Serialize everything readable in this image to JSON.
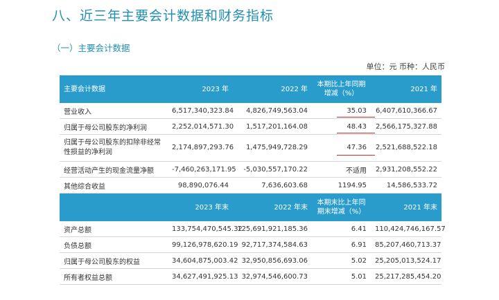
{
  "heading": "八、近三年主要会计数据和财务指标",
  "subheading": "（一）主要会计数据",
  "unit_line": "单位：元  币种：人民币",
  "table1": {
    "headers": [
      "主要会计数据",
      "2023 年",
      "2022 年",
      "本期比上年同期增减（%）",
      "2021 年"
    ],
    "rows": [
      {
        "name": "营业收入",
        "y2023": "6,517,340,323.84",
        "y2022": "4,826,749,563.04",
        "change": "35.03",
        "y2021": "6,407,610,366.67"
      },
      {
        "name": "归属于母公司股东的净利润",
        "y2023": "2,252,014,571.30",
        "y2022": "1,517,201,164.08",
        "change": "48.43",
        "y2021": "2,566,175,327.88"
      },
      {
        "name": "归属于母公司股东的扣除非经常性损益的净利润",
        "y2023": "2,174,897,293.76",
        "y2022": "1,475,949,728.29",
        "change": "47.36",
        "y2021": "2,521,688,522.18"
      },
      {
        "name": "经营活动产生的现金流量净额",
        "y2023": "-7,460,263,171.95",
        "y2022": "-5,030,557,170.22",
        "change": "不适用",
        "y2021": "2,931,208,552.22"
      },
      {
        "name": "其他综合收益",
        "y2023": "98,890,076.44",
        "y2022": "7,636,603.68",
        "change": "1194.95",
        "y2021": "14,586,533.72"
      }
    ]
  },
  "table2": {
    "headers": [
      "",
      "2023 年末",
      "2022 年末",
      "本期末比上年同期末增减（%）",
      "2021 年末"
    ],
    "rows": [
      {
        "name": "资产总额",
        "y2023": "133,754,470,545.32",
        "y2022": "125,691,921,185.36",
        "change": "6.41",
        "y2021": "110,424,746,167.57"
      },
      {
        "name": "负债总额",
        "y2023": "99,126,978,620.19",
        "y2022": "92,717,374,584.63",
        "change": "6.91",
        "y2021": "85,207,460,713.37"
      },
      {
        "name": "归属于母公司股东的权益",
        "y2023": "34,604,875,003.42",
        "y2022": "32,950,856,693.06",
        "change": "5.02",
        "y2021": "25,205,013,524.17"
      },
      {
        "name": "所有者权益总额",
        "y2023": "34,627,491,925.13",
        "y2022": "32,974,546,600.73",
        "change": "5.01",
        "y2021": "25,217,285,454.20"
      }
    ]
  },
  "colors": {
    "accent": "#1f8fb3",
    "header_bg": "#2a9ccc",
    "underline": "#d42a2a"
  }
}
